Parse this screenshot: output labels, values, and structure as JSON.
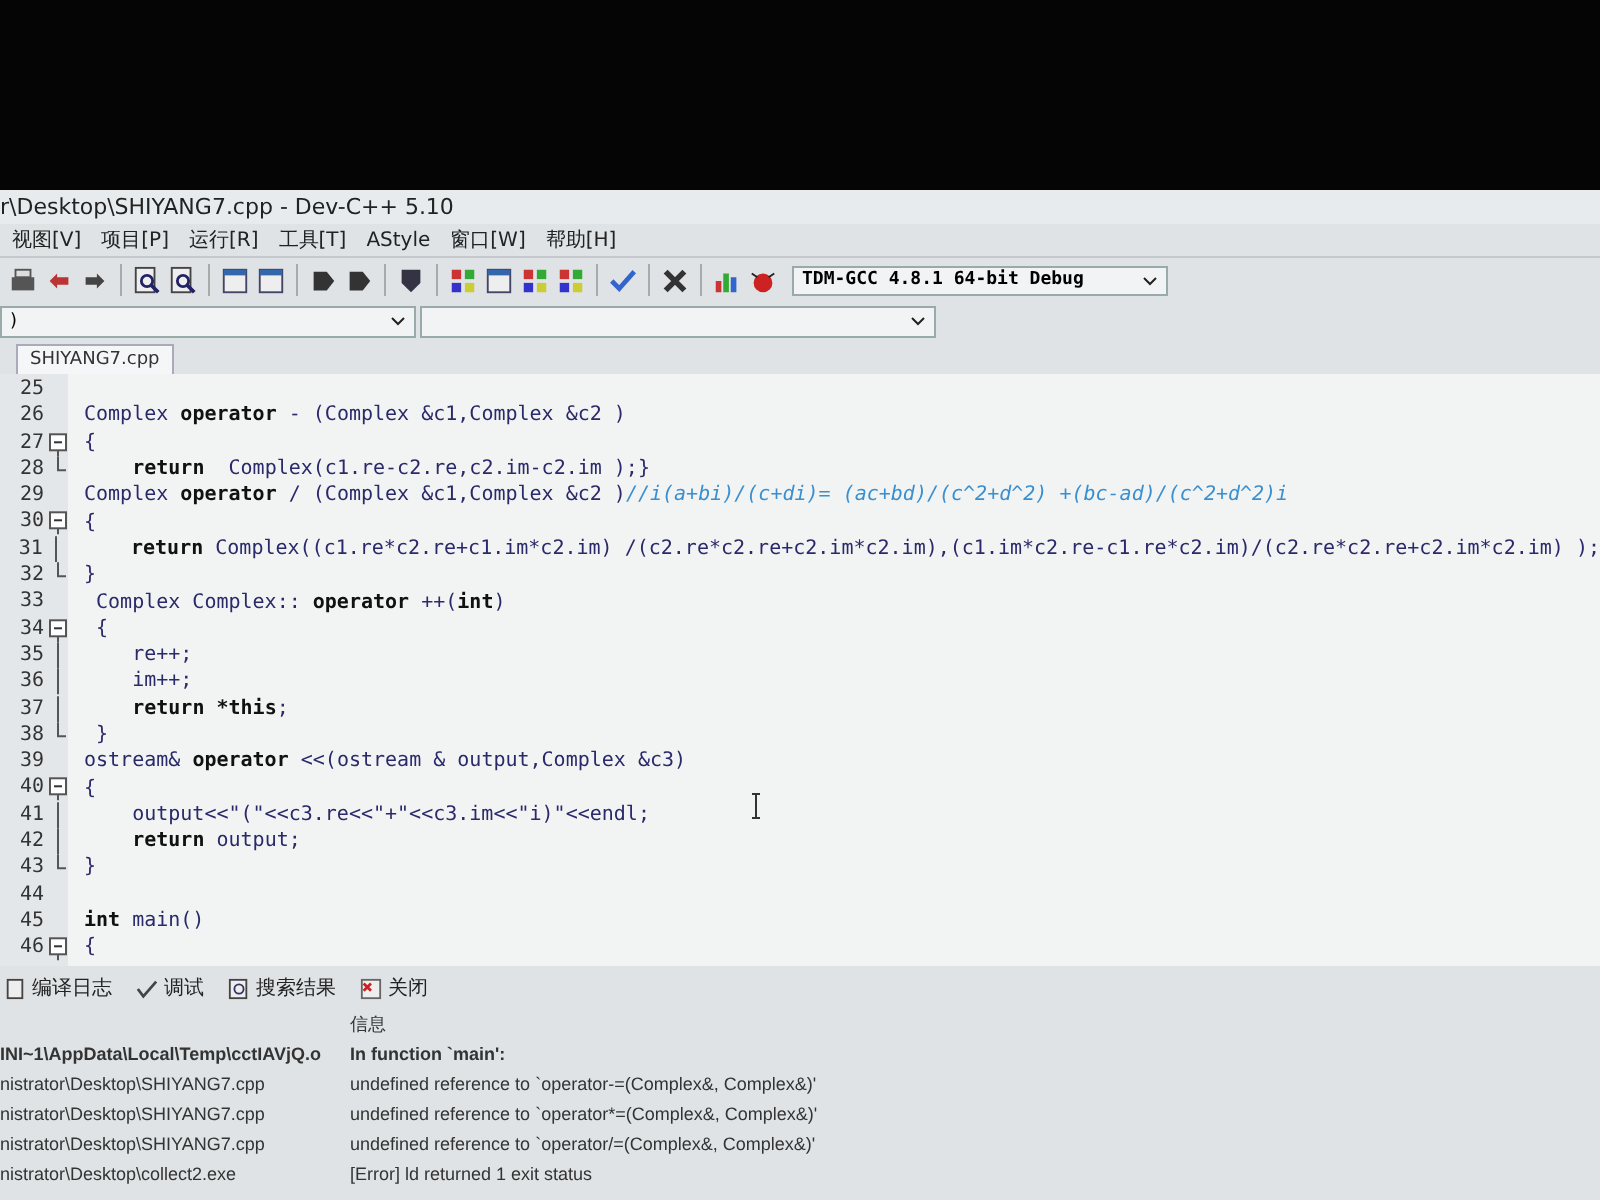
{
  "window": {
    "title": "r\\Desktop\\SHIYANG7.cpp - Dev-C++ 5.10"
  },
  "menu": [
    "视图[V]",
    "项目[P]",
    "运行[R]",
    "工具[T]",
    "AStyle",
    "窗口[W]",
    "帮助[H]"
  ],
  "compiler_select": {
    "value": "TDM-GCC 4.8.1 64-bit Debug"
  },
  "class_select": {
    "value": ")"
  },
  "tabs": [
    {
      "label": "SHIYANG7.cpp",
      "selected": true
    }
  ],
  "editor": {
    "lines": [
      {
        "number": "25",
        "kind": "plain"
      },
      {
        "number": "26",
        "text": "Complex **operator** - (Complex &c1,Complex &c2 )",
        "kind": "plain"
      },
      {
        "number": "27",
        "text": "{",
        "kind": "fold-open"
      },
      {
        "number": "28",
        "text": "    **return**  Complex(c1.re-c2.re,c2.im-c2.im );}",
        "kind": "fold-end"
      },
      {
        "number": "29",
        "text": "Complex **operator** / (Complex &c1,Complex &c2 )",
        "comment": "//i(a+bi)/(c+di)= (ac+bd)/(c^2+d^2) +(bc-ad)/(c^2+d^2)i",
        "kind": "plain"
      },
      {
        "number": "30",
        "text": "{",
        "kind": "fold-open"
      },
      {
        "number": "31",
        "text": "    **return** Complex((c1.re*c2.re+c1.im*c2.im) /(c2.re*c2.re+c2.im*c2.im),(c1.im*c2.re-c1.re*c2.im)/(c2.re*c2.re+c2.im*c2.im) );",
        "kind": "fold-line"
      },
      {
        "number": "32",
        "text": "}",
        "kind": "fold-end"
      },
      {
        "number": "33",
        "text": " Complex Complex:: **operator** ++(**int**)",
        "kind": "plain"
      },
      {
        "number": "34",
        "text": " {",
        "kind": "fold-open"
      },
      {
        "number": "35",
        "text": "    re++;",
        "kind": "fold-line"
      },
      {
        "number": "36",
        "text": "    im++;",
        "kind": "fold-line"
      },
      {
        "number": "37",
        "text": "    **return** ***this**;",
        "kind": "fold-line"
      },
      {
        "number": "38",
        "text": " }",
        "kind": "fold-end"
      },
      {
        "number": "39",
        "text": "ostream& **operator** <<(ostream & output,Complex &c3)",
        "kind": "plain"
      },
      {
        "number": "40",
        "text": "{",
        "kind": "fold-open"
      },
      {
        "number": "41",
        "text": "    output<<\"(\"<<c3.re<<\"+\"<<c3.im<<\"i)\"<<endl;",
        "kind": "fold-line"
      },
      {
        "number": "42",
        "text": "    **return** output;",
        "kind": "fold-line"
      },
      {
        "number": "43",
        "text": "}",
        "kind": "fold-end"
      },
      {
        "number": "44",
        "kind": "plain"
      },
      {
        "number": "45",
        "text": "**int** main()",
        "kind": "plain"
      },
      {
        "number": "46",
        "text": "{",
        "kind": "fold-open"
      }
    ]
  },
  "bottom_tabs": [
    {
      "label": "编译日志",
      "selected": false
    },
    {
      "label": "调试",
      "selected": false
    },
    {
      "label": "搜索结果",
      "selected": false
    },
    {
      "label": "关闭",
      "selected": false
    }
  ],
  "messages": {
    "column_2": "信息",
    "rows": [
      {
        "file": "INI~1\\AppData\\Local\\Temp\\cctIAVjQ.o",
        "message": "In function `main':",
        "bold": true
      },
      {
        "file": "nistrator\\Desktop\\SHIYANG7.cpp",
        "message": "undefined reference to `operator-=(Complex&, Complex&)'",
        "bold": false
      },
      {
        "file": "nistrator\\Desktop\\SHIYANG7.cpp",
        "message": "undefined reference to `operator*=(Complex&, Complex&)'",
        "bold": false
      },
      {
        "file": "nistrator\\Desktop\\SHIYANG7.cpp",
        "message": "undefined reference to `operator/=(Complex&, Complex&)'",
        "bold": false
      },
      {
        "file": "nistrator\\Desktop\\collect2.exe",
        "message": "[Error] ld returned 1 exit status",
        "bold": false
      }
    ]
  }
}
